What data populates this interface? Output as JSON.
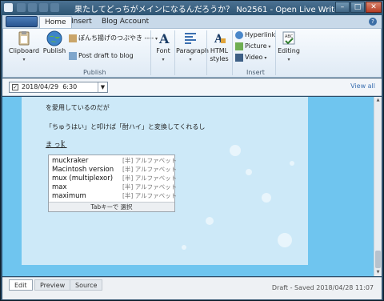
{
  "window": {
    "title": "果たしてどっちがメインになるんだろうか？  No2561 - Open Live Writer",
    "controls": {
      "minimize": "–",
      "maximize": "□",
      "close": "✕"
    }
  },
  "ribbon": {
    "tabs": [
      "Home",
      "Insert",
      "Blog Account"
    ],
    "active_tab": "Home",
    "groups": {
      "publish": {
        "label": "Publish",
        "clipboard": "Clipboard",
        "publish": "Publish",
        "blog_name": "ぽんち揚げのつぶやき ----",
        "post_draft": "Post draft to blog"
      },
      "font": "Font",
      "paragraph": "Paragraph",
      "html_styles_line1": "HTML",
      "html_styles_line2": "styles",
      "insert": {
        "label": "Insert",
        "hyperlink": "Hyperlink",
        "picture": "Picture",
        "video": "Video"
      },
      "editing": "Editing"
    }
  },
  "datebar": {
    "date": "2018/04/29",
    "time": "6:30",
    "view_all": "View all"
  },
  "editor": {
    "paragraphs": [
      "を愛用しているのだが",
      "「ちゅうはい」と叩けば「酎ハイ」と変換してくれるし",
      "ま っく"
    ],
    "autocomplete": {
      "items": [
        {
          "word": "muckraker",
          "tag": "[半] アルファベット"
        },
        {
          "word": "Macintosh version",
          "tag": "[半] アルファベット"
        },
        {
          "word": "mux (multiplexor)",
          "tag": "[半] アルファベット"
        },
        {
          "word": "max",
          "tag": "[半] アルファベット"
        },
        {
          "word": "maximum",
          "tag": "[半] アルファベット"
        }
      ],
      "footer": "Tabキーで 選択"
    }
  },
  "statusbar": {
    "views": [
      "Edit",
      "Preview",
      "Source"
    ],
    "active_view": "Edit",
    "status": "Draft - Saved 2018/04/28 11:07"
  },
  "colors": {
    "editor_bg": "#6fc5ef",
    "content_bg": "#cde9f8",
    "titlebar": "#2e5573",
    "accent": "#3a6fb0"
  }
}
